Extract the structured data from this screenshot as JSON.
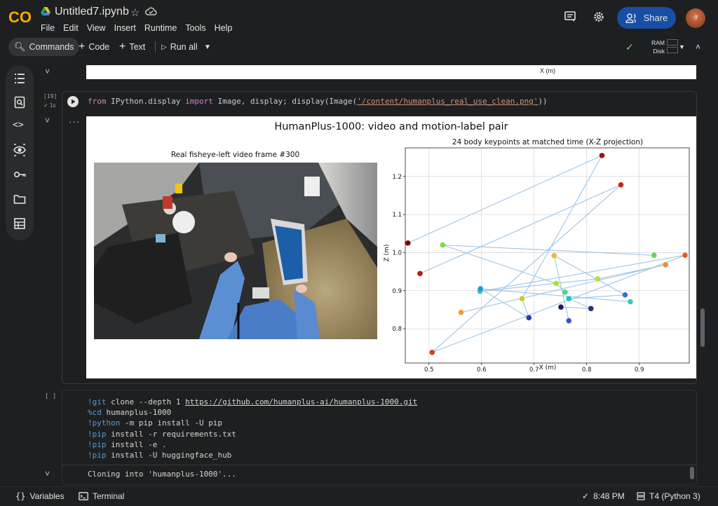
{
  "header": {
    "logo_text": "CO",
    "notebook_title": "Untitled7.ipynb",
    "menu": [
      "File",
      "Edit",
      "View",
      "Insert",
      "Runtime",
      "Tools",
      "Help"
    ],
    "share_label": "Share",
    "avatar_text": "ঔ"
  },
  "toolbar": {
    "commands_label": "Commands",
    "code_label": "Code",
    "text_label": "Text",
    "run_all_label": "Run all",
    "ram_label": "RAM",
    "disk_label": "Disk"
  },
  "cells": {
    "cell1_xlabel": "X (m)",
    "cell2": {
      "exec_count": "[19]",
      "exec_time": "1s",
      "code_from": "from",
      "code_module": " IPython.display ",
      "code_import": "import",
      "code_names": " Image, display; display(Image(",
      "code_path": "'/content/humanplus_real_use_clean.png'",
      "code_end": "))"
    },
    "cell3": {
      "bracket": "[ ]",
      "lines": [
        {
          "prefix": "!git clone --depth 1 ",
          "url": "https://github.com/humanplus-ai/humanplus-1000.git"
        },
        {
          "prefix": "%cd humanplus-1000",
          "url": ""
        },
        {
          "prefix": "!python -m pip install -U pip",
          "url": ""
        },
        {
          "prefix": "!pip install -r requirements.txt",
          "url": ""
        },
        {
          "prefix": "!pip install -e .",
          "url": ""
        },
        {
          "prefix": "!pip install -U huggingface_hub",
          "url": ""
        }
      ],
      "output": "Cloning into 'humanplus-1000'..."
    }
  },
  "figure": {
    "title": "HumanPlus-1000: video and motion-label pair",
    "frame_title": "Real fisheye-left video frame #300"
  },
  "chart_data": {
    "type": "scatter",
    "title": "24 body keypoints at matched time (X-Z projection)",
    "xlabel": "X (m)",
    "ylabel": "Z (m)",
    "xlim": [
      0.455,
      0.995
    ],
    "ylim": [
      0.71,
      1.275
    ],
    "xticks": [
      0.5,
      0.6,
      0.7,
      0.8,
      0.9,
      1.0
    ],
    "xtick_labels": [
      "0.5",
      "0.6",
      "0.7",
      "0.8",
      "0.9",
      "1.0"
    ],
    "yticks": [
      0.8,
      0.9,
      1.0,
      1.1,
      1.2
    ],
    "ytick_labels": [
      "0.8",
      "0.9",
      "1.0",
      "1.1",
      "1.2"
    ],
    "grid": true,
    "line_color": "#9ec4e3",
    "points": [
      {
        "x": 0.46,
        "y": 1.025,
        "color": "#800000"
      },
      {
        "x": 0.483,
        "y": 0.945,
        "color": "#b71c0c"
      },
      {
        "x": 0.506,
        "y": 0.738,
        "color": "#d6401a"
      },
      {
        "x": 0.829,
        "y": 1.255,
        "color": "#a80f0f"
      },
      {
        "x": 0.865,
        "y": 1.178,
        "color": "#c7260e"
      },
      {
        "x": 0.987,
        "y": 0.993,
        "color": "#e8601a"
      },
      {
        "x": 0.95,
        "y": 0.968,
        "color": "#f28a2e"
      },
      {
        "x": 0.561,
        "y": 0.843,
        "color": "#f59a30"
      },
      {
        "x": 0.738,
        "y": 0.992,
        "color": "#f7b440"
      },
      {
        "x": 0.677,
        "y": 0.879,
        "color": "#d4c62a"
      },
      {
        "x": 0.526,
        "y": 1.02,
        "color": "#7fdc3a"
      },
      {
        "x": 0.928,
        "y": 0.993,
        "color": "#63d64a"
      },
      {
        "x": 0.742,
        "y": 0.919,
        "color": "#a5e13a"
      },
      {
        "x": 0.821,
        "y": 0.931,
        "color": "#b8e03a"
      },
      {
        "x": 0.759,
        "y": 0.896,
        "color": "#4ed87a"
      },
      {
        "x": 0.597,
        "y": 0.898,
        "color": "#35d4a0"
      },
      {
        "x": 0.883,
        "y": 0.871,
        "color": "#33c9c0"
      },
      {
        "x": 0.766,
        "y": 0.879,
        "color": "#2bb7d8"
      },
      {
        "x": 0.598,
        "y": 0.905,
        "color": "#2a8fe0"
      },
      {
        "x": 0.873,
        "y": 0.889,
        "color": "#2f6fe0"
      },
      {
        "x": 0.766,
        "y": 0.821,
        "color": "#3455c8"
      },
      {
        "x": 0.69,
        "y": 0.829,
        "color": "#2a3ea8"
      },
      {
        "x": 0.808,
        "y": 0.853,
        "color": "#23307a"
      },
      {
        "x": 0.751,
        "y": 0.857,
        "color": "#1a1a5e"
      }
    ],
    "edges": [
      [
        0,
        3
      ],
      [
        1,
        4
      ],
      [
        2,
        5
      ],
      [
        7,
        6
      ],
      [
        10,
        11
      ],
      [
        14,
        12
      ],
      [
        15,
        13
      ],
      [
        19,
        17
      ],
      [
        18,
        16
      ],
      [
        8,
        20
      ],
      [
        9,
        21
      ],
      [
        23,
        22
      ],
      [
        3,
        9
      ],
      [
        4,
        2
      ],
      [
        6,
        13
      ],
      [
        5,
        15
      ],
      [
        10,
        12
      ],
      [
        17,
        22
      ],
      [
        19,
        8
      ],
      [
        21,
        18
      ]
    ]
  },
  "statusbar": {
    "variables_label": "Variables",
    "terminal_label": "Terminal",
    "time": "8:48 PM",
    "runtime": "T4 (Python 3)"
  }
}
